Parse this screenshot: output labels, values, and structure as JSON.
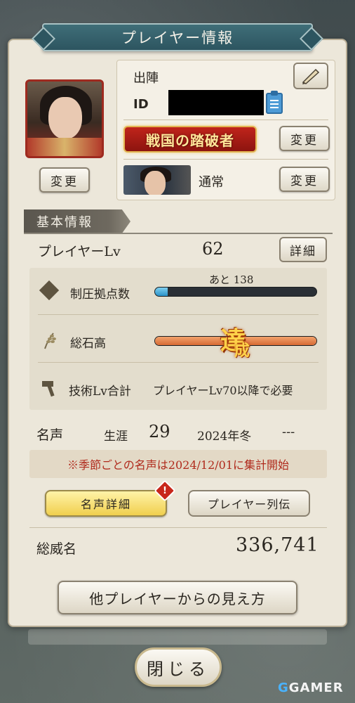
{
  "header": {
    "title": "プレイヤー情報"
  },
  "profile": {
    "avatar_change_label": "変更",
    "sortie_label": "出陣",
    "id_label": "ID",
    "title_badge_text": "戦国の踏破者",
    "title_change_label": "変更",
    "display_mode_label": "通常",
    "display_change_label": "変更"
  },
  "basic": {
    "section_title": "基本情報",
    "player_lv_label": "プレイヤーLv",
    "player_lv_value": "62",
    "detail_button_label": "詳細",
    "stats": {
      "conquest": {
        "label": "制圧拠点数",
        "remaining_label": "あと 138",
        "progress": 0.08
      },
      "koku": {
        "label": "総石高",
        "achieved_mark": "達",
        "achieved_mark_sub": "成",
        "progress": 1.0
      },
      "tech": {
        "label": "技術Lv合計",
        "note": "プレイヤーLv70以降で必要"
      }
    }
  },
  "fame": {
    "label": "名声",
    "career_label": "生涯",
    "career_value": "29",
    "season_label": "2024年冬",
    "season_value": "---",
    "notice": "※季節ごとの名声は2024/12/01に集計開始",
    "fame_detail_button": "名声詳細",
    "alert_mark": "!",
    "chronicle_button": "プレイヤー列伝"
  },
  "total": {
    "label": "総威名",
    "value": "336,741"
  },
  "view_button_label": "他プレイヤーからの見え方",
  "close_button_label": "閉じる",
  "watermark": {
    "prefix": "G",
    "text": "GAMER"
  },
  "colors": {
    "title_bar": "#2d5560",
    "panel": "#ece7da",
    "accent_red": "#b02a1c",
    "fame_button": "#f0cf4e",
    "progress_blue": "#2a92c8",
    "progress_orange": "#d66a34"
  },
  "icons": [
    "pen-icon",
    "clipboard-icon",
    "diamond-icon",
    "rice-icon",
    "hammer-icon",
    "alert-icon"
  ]
}
